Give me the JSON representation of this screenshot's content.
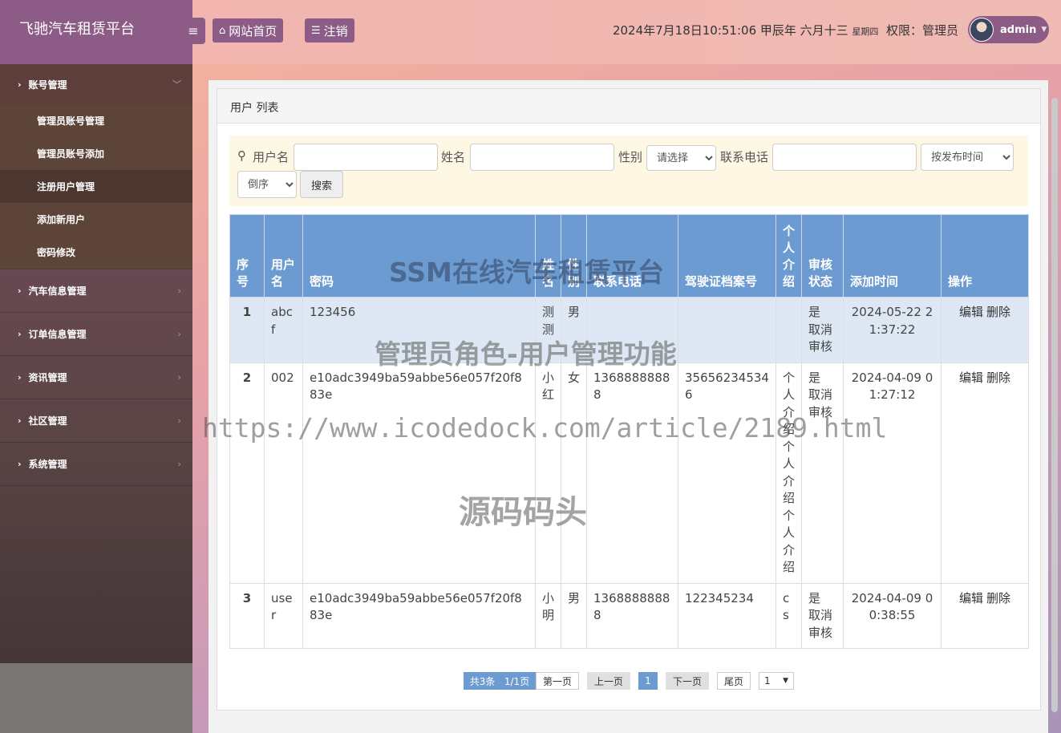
{
  "brand": "飞驰汽车租赁平台",
  "header": {
    "home_label": "网站首页",
    "logout_label": "注销",
    "datetime": "2024年7月18日10:51:06 甲辰年 六月十三",
    "weekday": "星期四",
    "role_label": "权限：管理员",
    "username": "admin"
  },
  "sidebar": {
    "groups": [
      {
        "label": "账号管理",
        "items": [
          "管理员账号管理",
          "管理员账号添加",
          "注册用户管理",
          "添加新用户",
          "密码修改"
        ]
      },
      {
        "label": "汽车信息管理"
      },
      {
        "label": "订单信息管理"
      },
      {
        "label": "资讯管理"
      },
      {
        "label": "社区管理"
      },
      {
        "label": "系统管理"
      }
    ]
  },
  "panel": {
    "title": "用户 列表"
  },
  "search": {
    "username_label": "用户名",
    "name_label": "姓名",
    "gender_label": "性别",
    "gender_selected": "请选择",
    "phone_label": "联系电话",
    "sort_field": "按发布时间",
    "sort_order": "倒序",
    "search_button": "搜索"
  },
  "table": {
    "headers": [
      "序号",
      "用户名",
      "密码",
      "姓名",
      "性别",
      "联系电话",
      "驾驶证档案号",
      "个人介绍",
      "审核状态",
      "添加时间",
      "操作"
    ],
    "rows": [
      {
        "idx": "1",
        "username": "abcf",
        "password": "123456",
        "name": "测测",
        "gender": "男",
        "phone": "",
        "license": "",
        "intro": "",
        "status": "是",
        "status_action": "取消审核",
        "added": "2024-05-22 21:37:22"
      },
      {
        "idx": "2",
        "username": "002",
        "password": "e10adc3949ba59abbe56e057f20f883e",
        "name": "小红",
        "gender": "女",
        "phone": "13688888888",
        "license": "356562345346",
        "intro": "个人介绍个人介绍个人介绍",
        "status": "是",
        "status_action": "取消审核",
        "added": "2024-04-09 01:27:12"
      },
      {
        "idx": "3",
        "username": "user",
        "password": "e10adc3949ba59abbe56e057f20f883e",
        "name": "小明",
        "gender": "男",
        "phone": "13688888888",
        "license": "122345234",
        "intro": "cs",
        "status": "是",
        "status_action": "取消审核",
        "added": "2024-04-09 00:38:55"
      }
    ],
    "edit_label": "编辑",
    "delete_label": "删除"
  },
  "pager": {
    "total": "共3条",
    "pages": "1/1页",
    "first": "第一页",
    "prev": "上一页",
    "current": "1",
    "next": "下一页",
    "last": "尾页",
    "jump_selected": "1"
  },
  "watermarks": [
    "SSM在线汽车租赁平台",
    "管理员角色-用户管理功能",
    "https://www.icodedock.com/article/2189.html",
    "源码码头"
  ],
  "colors": {
    "accent": "#8d5c86",
    "table_header": "#6c9bd2",
    "search_bg": "#fdf7e3"
  }
}
